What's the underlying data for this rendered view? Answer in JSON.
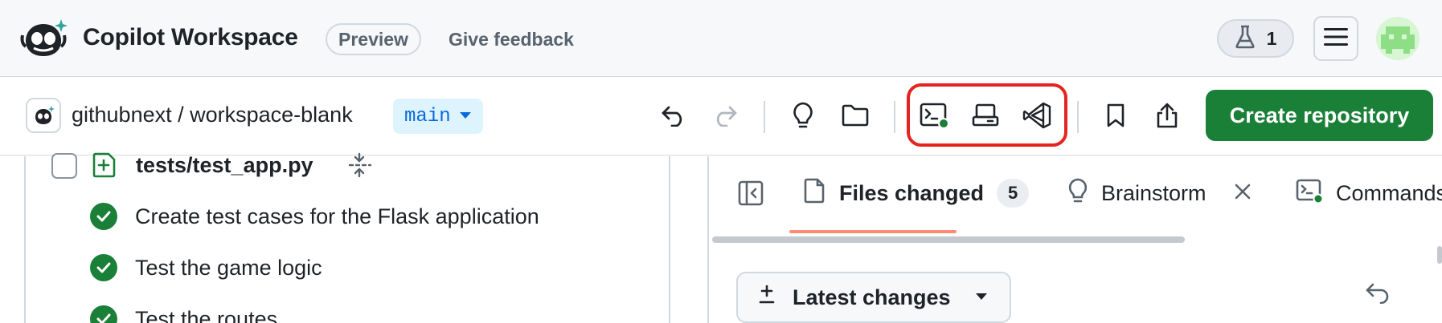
{
  "header": {
    "app_title": "Copilot Workspace",
    "preview_badge": "Preview",
    "feedback_link": "Give feedback",
    "labs_count": "1",
    "icons": [
      "copilot-logo-icon",
      "beaker-icon",
      "hamburger-menu-icon",
      "avatar"
    ]
  },
  "toolbar": {
    "repo_path": "githubnext / workspace-blank",
    "branch": "main",
    "create_repo_label": "Create repository",
    "highlight_color": "#e5231f",
    "icons": [
      "undo-icon",
      "redo-icon",
      "lightbulb-icon",
      "folder-icon",
      "terminal-icon",
      "codespace-icon",
      "vscode-icon",
      "bookmark-icon",
      "share-icon"
    ]
  },
  "left_pane": {
    "file": {
      "name": "tests/test_app.py"
    },
    "tasks": [
      {
        "text": "Create test cases for the Flask application",
        "done": true
      },
      {
        "text": "Test the game logic",
        "done": true
      },
      {
        "text": "Test the routes",
        "done": true
      }
    ]
  },
  "right_pane": {
    "tabs": [
      {
        "label": "Files changed",
        "count": "5",
        "active": true
      },
      {
        "label": "Brainstorm"
      },
      {
        "label": "Commands"
      }
    ],
    "latest_changes_label": "Latest changes"
  },
  "colors": {
    "primary_green": "#1a7f37",
    "link_blue": "#0969da",
    "branch_bg": "#ddf4ff",
    "active_tab_underline": "#fd8c73"
  }
}
